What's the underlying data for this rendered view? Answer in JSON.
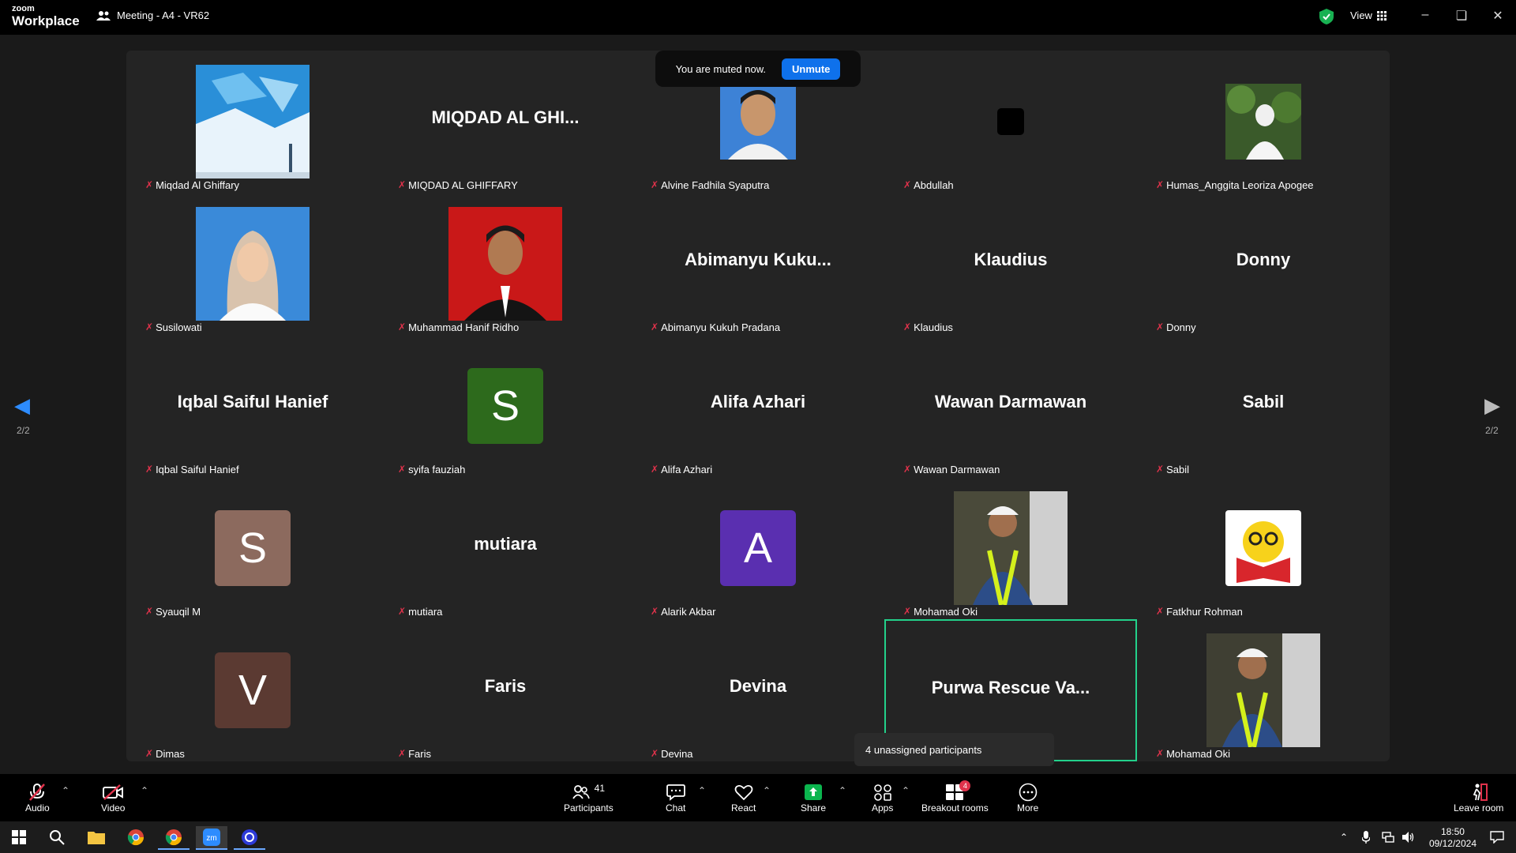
{
  "titlebar": {
    "brand_small": "zoom",
    "brand_large": "Workplace",
    "meeting_title": "Meeting - A4 - VR62",
    "view_label": "View"
  },
  "toast": {
    "message": "You are muted now.",
    "unmute_label": "Unmute"
  },
  "page_indicator": "2/2",
  "tiles": [
    {
      "label": "Miqdad Al Ghiffary",
      "display": "photo"
    },
    {
      "label": "MIQDAD AL GHIFFARY",
      "display": "text",
      "big": "MIQDAD AL GHI..."
    },
    {
      "label": "Alvine Fadhila Syaputra",
      "display": "photo"
    },
    {
      "label": "Abdullah",
      "display": "photo"
    },
    {
      "label": "Humas_Anggita Leoriza Apogee",
      "display": "photo"
    },
    {
      "label": "Susilowati",
      "display": "photo"
    },
    {
      "label": "Muhammad Hanif Ridho",
      "display": "photo"
    },
    {
      "label": "Abimanyu Kukuh Pradana",
      "display": "text",
      "big": "Abimanyu  Kuku..."
    },
    {
      "label": "Klaudius",
      "display": "text",
      "big": "Klaudius"
    },
    {
      "label": "Donny",
      "display": "text",
      "big": "Donny"
    },
    {
      "label": "Iqbal Saiful Hanief",
      "display": "text",
      "big": "Iqbal Saiful Hanief"
    },
    {
      "label": "syifa fauziah",
      "display": "letter",
      "letter": "S",
      "color": "#2d6a1c"
    },
    {
      "label": "Alifa Azhari",
      "display": "text",
      "big": "Alifa Azhari"
    },
    {
      "label": "Wawan Darmawan",
      "display": "text",
      "big": "Wawan Darmawan"
    },
    {
      "label": "Sabil",
      "display": "text",
      "big": "Sabil"
    },
    {
      "label": "Syauqil M",
      "display": "letter",
      "letter": "S",
      "color": "#8c6a5e"
    },
    {
      "label": "mutiara",
      "display": "text",
      "big": "mutiara"
    },
    {
      "label": "Alarik Akbar",
      "display": "letter",
      "letter": "A",
      "color": "#5a2fb0"
    },
    {
      "label": "Mohamad Oki",
      "display": "photo"
    },
    {
      "label": "Fatkhur Rohman",
      "display": "photo"
    },
    {
      "label": "Dimas",
      "display": "letter",
      "letter": "V",
      "color": "#5b3a32"
    },
    {
      "label": "Faris",
      "display": "text",
      "big": "Faris"
    },
    {
      "label": "Devina",
      "display": "text",
      "big": "Devina"
    },
    {
      "label": "",
      "display": "text",
      "big": "Purwa Rescue Va..."
    },
    {
      "label": "Mohamad Oki",
      "display": "photo"
    }
  ],
  "unassigned": "4 unassigned participants",
  "toolbar": {
    "audio": "Audio",
    "video": "Video",
    "participants": "Participants",
    "participant_count": "41",
    "chat": "Chat",
    "react": "React",
    "share": "Share",
    "apps": "Apps",
    "breakout": "Breakout rooms",
    "breakout_badge": "4",
    "more": "More",
    "leave": "Leave room"
  },
  "taskbar": {
    "time": "18:50",
    "date": "09/12/2024"
  },
  "colors": {
    "accent": "#0e71eb",
    "muted_red": "#e0324b",
    "active_border": "#23d18b",
    "share_green": "#0bb54e"
  }
}
